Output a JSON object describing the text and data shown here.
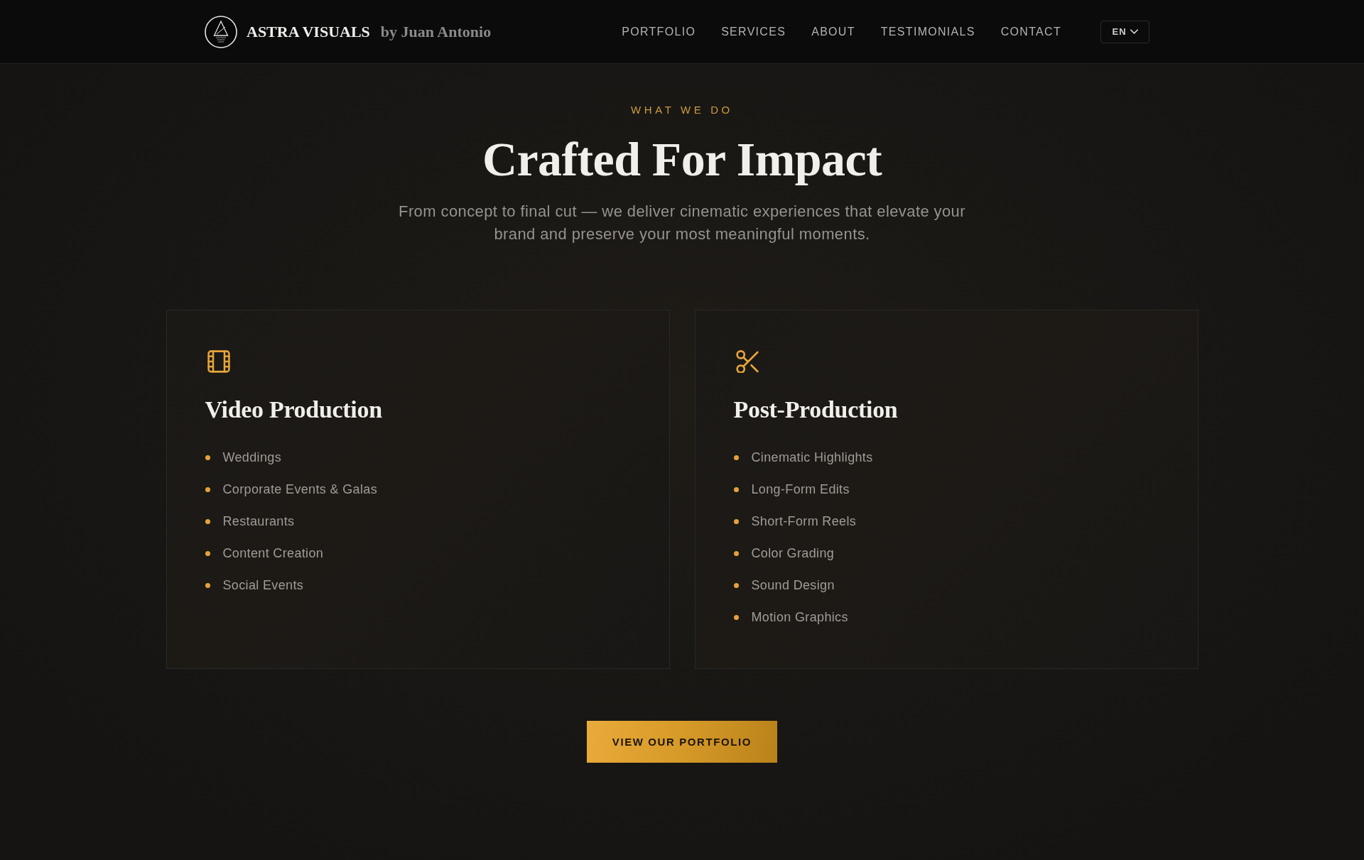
{
  "header": {
    "brand": {
      "name": "ASTRA VISUALS",
      "byline": "by Juan Antonio"
    },
    "nav": [
      {
        "label": "PORTFOLIO"
      },
      {
        "label": "SERVICES"
      },
      {
        "label": "ABOUT"
      },
      {
        "label": "TESTIMONIALS"
      },
      {
        "label": "CONTACT"
      }
    ],
    "language": {
      "label": "EN"
    }
  },
  "intro": {
    "eyebrow": "WHAT WE DO",
    "title": "Crafted For Impact",
    "subtitle": "From concept to final cut — we deliver cinematic experiences that elevate your brand and preserve your most meaningful moments."
  },
  "cards": [
    {
      "title": "Video Production",
      "items": [
        "Weddings",
        "Corporate Events & Galas",
        "Restaurants",
        "Content Creation",
        "Social Events"
      ]
    },
    {
      "title": "Post-Production",
      "items": [
        "Cinematic Highlights",
        "Long-Form Edits",
        "Short-Form Reels",
        "Color Grading",
        "Sound Design",
        "Motion Graphics"
      ]
    }
  ],
  "cta": {
    "label": "VIEW OUR PORTFOLIO"
  }
}
